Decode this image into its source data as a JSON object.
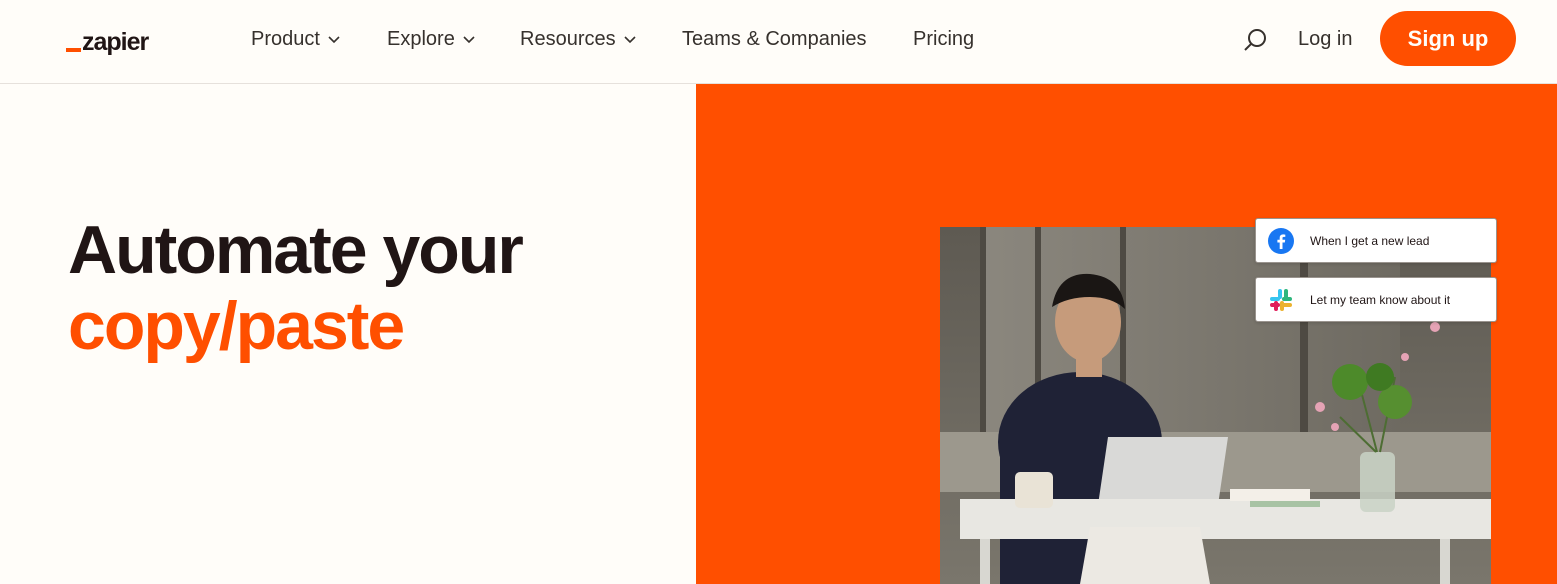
{
  "header": {
    "logo_text": "zapier",
    "nav": [
      {
        "label": "Product",
        "has_dropdown": true
      },
      {
        "label": "Explore",
        "has_dropdown": true
      },
      {
        "label": "Resources",
        "has_dropdown": true
      },
      {
        "label": "Teams & Companies",
        "has_dropdown": false
      },
      {
        "label": "Pricing",
        "has_dropdown": false
      }
    ],
    "search_icon": "search-icon",
    "login_label": "Log in",
    "signup_label": "Sign up"
  },
  "hero": {
    "title_line1": "Automate your",
    "title_line2": "copy/paste"
  },
  "workflow_cards": [
    {
      "icon": "facebook-icon",
      "text": "When I get a new lead"
    },
    {
      "icon": "slack-icon",
      "text": "Let my team know about it"
    }
  ],
  "colors": {
    "brand_orange": "#ff4f00",
    "background": "#fffdf9",
    "text_dark": "#201515"
  }
}
